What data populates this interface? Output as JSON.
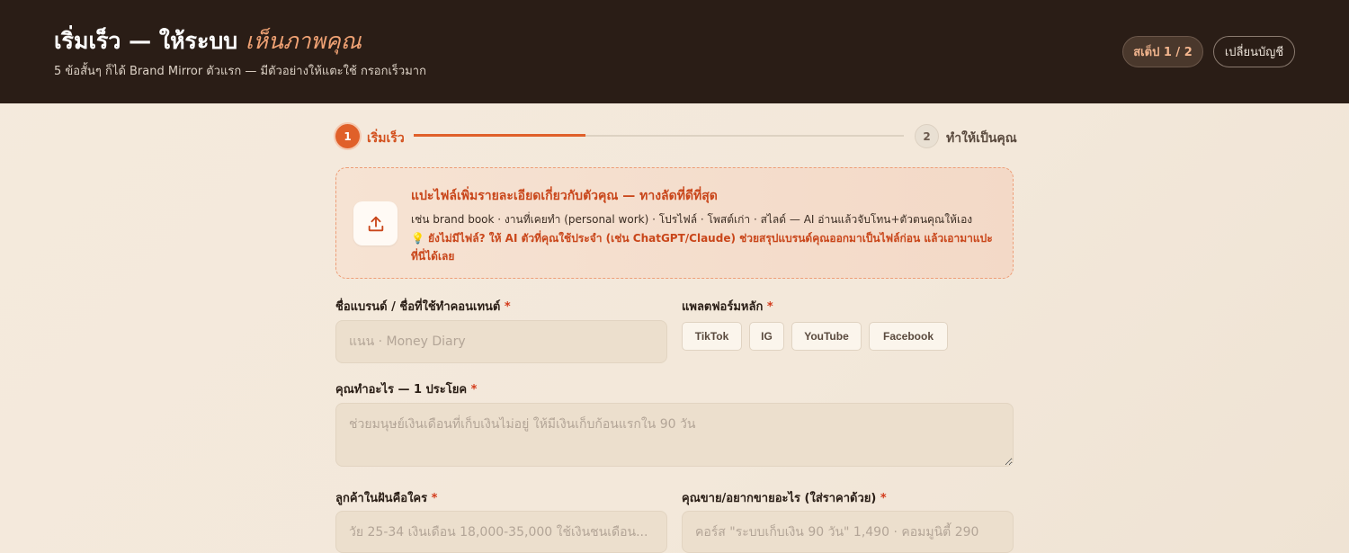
{
  "header": {
    "title_main": "เริ่มเร็ว — ให้ระบบ",
    "title_accent": "เห็นภาพคุณ",
    "subtitle": "5 ข้อสั้นๆ ก็ได้ Brand Mirror ตัวแรก — มีตัวอย่างให้แตะใช้ กรอกเร็วมาก",
    "step_badge": "สเต็ป 1 / 2",
    "switch_account_label": "เปลี่ยนบัญชี"
  },
  "stepper": {
    "steps": [
      {
        "number": "1",
        "label": "เริ่มเร็ว",
        "active": true
      },
      {
        "number": "2",
        "label": "ทำให้เป็นคุณ",
        "active": false
      }
    ],
    "progress": 0.35
  },
  "upload": {
    "icon": "upload-icon",
    "title": "แปะไฟล์เพิ่มรายละเอียดเกี่ยวกับตัวคุณ — ทางลัดที่ดีที่สุด",
    "description": "เช่น brand book · งานที่เคยทำ (personal work) · โปรไฟล์ · โพสต์เก่า · สไลด์ — AI อ่านแล้วจับโทน+ตัวตนคุณให้เอง",
    "tip_icon": "💡",
    "tip": "ยังไม่มีไฟล์? ให้ AI ตัวที่คุณใช้ประจำ (เช่น ChatGPT/Claude) ช่วยสรุปแบรนด์คุณออกมาเป็นไฟล์ก่อน แล้วเอามาแปะที่นี่ได้เลย"
  },
  "form": {
    "brand_name": {
      "label": "ชื่อแบรนด์ / ชื่อที่ใช้ทำคอนเทนต์",
      "required": "*",
      "value": "",
      "placeholder": "แนน · Money Diary"
    },
    "platform": {
      "label": "แพลตฟอร์มหลัก",
      "required": "*",
      "options": [
        "TikTok",
        "IG",
        "YouTube",
        "Facebook"
      ]
    },
    "what_you_do": {
      "label": "คุณทำอะไร — 1 ประโยค",
      "required": "*",
      "value": "",
      "placeholder": "ช่วยมนุษย์เงินเดือนที่เก็บเงินไม่อยู่ ให้มีเงินเก็บก้อนแรกใน 90 วัน"
    },
    "dream_customer": {
      "label": "ลูกค้าในฝันคือใคร",
      "required": "*",
      "value": "",
      "placeholder": "วัย 25-34 เงินเดือน 18,000-35,000 ใช้เงินชนเดือน..."
    },
    "offer": {
      "label": "คุณขาย/อยากขายอะไร (ใส่ราคาด้วย)",
      "required": "*",
      "value": "",
      "placeholder": "คอร์ส \"ระบบเก็บเงิน 90 วัน\" 1,490 · คอมมูนิตี้ 290"
    }
  },
  "colors": {
    "header_bg": "#2a1d16",
    "accent": "#e0602a",
    "page_bg": "#f4eadd"
  }
}
